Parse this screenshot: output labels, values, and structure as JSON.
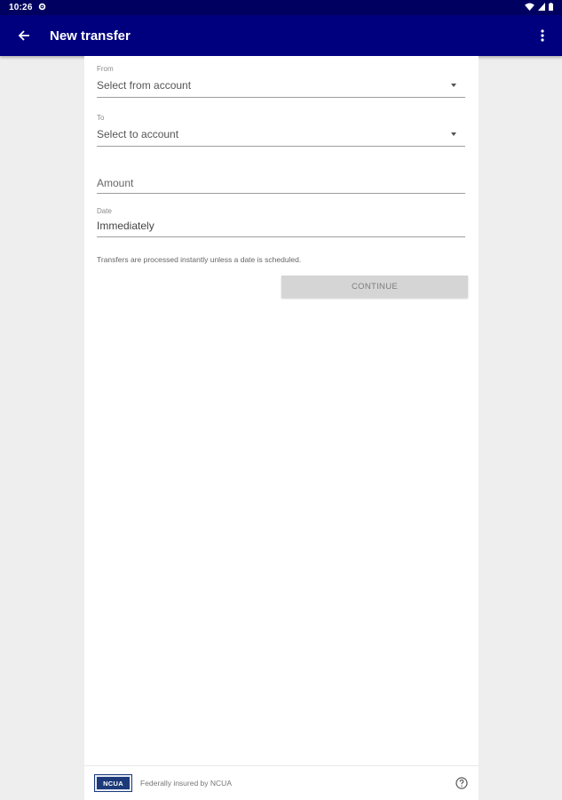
{
  "status_bar": {
    "time": "10:26",
    "icons": [
      "settings-icon",
      "wifi-icon",
      "signal-icon",
      "battery-icon"
    ]
  },
  "app_bar": {
    "title": "New transfer",
    "back_icon": "arrow-back-icon",
    "menu_icon": "more-vert-icon",
    "background": "#00007f"
  },
  "form": {
    "from": {
      "label": "From",
      "value": "Select from account"
    },
    "to": {
      "label": "To",
      "value": "Select to account"
    },
    "amount": {
      "placeholder": "Amount"
    },
    "date": {
      "label": "Date",
      "value": "Immediately"
    },
    "note": "Transfers are processed instantly unless a date is scheduled.",
    "continue_label": "CONTINUE"
  },
  "footer": {
    "logo_text": "NCUA",
    "insured_text": "Federally insured by NCUA",
    "help_icon": "help-icon"
  }
}
